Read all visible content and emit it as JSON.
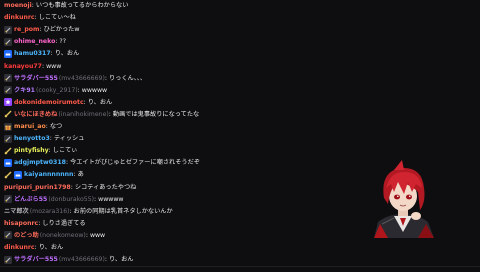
{
  "chat": {
    "messages": [
      {
        "name": "moenoji",
        "name_color": "#ff6b5b",
        "badge": "",
        "handle": "",
        "text": "いつも事故ってるからわからない"
      },
      {
        "name": "dinkunrc",
        "name_color": "#ff5a4a",
        "badge": "",
        "handle": "",
        "text": "しこてぃ〜ね"
      },
      {
        "name": "re_pom",
        "name_color": "#ff5a4a",
        "badge": "sword-badge-icon",
        "handle": "",
        "text": "ひどかったw"
      },
      {
        "name": "ohime_neko",
        "name_color": "#ff66cc",
        "badge": "sword-badge-icon",
        "handle": "",
        "text": "??"
      },
      {
        "name": "hamu0317",
        "name_color": "#4db6ff",
        "badge": "prime-crown-badge-icon",
        "handle": "",
        "text": "り、おん"
      },
      {
        "name": "kanayou77",
        "name_color": "#ff3b3b",
        "badge": "",
        "handle": "",
        "text": "www"
      },
      {
        "name": "サラダバー555",
        "name_color": "#c070ff",
        "badge": "sword-badge-icon",
        "handle": "(mv43666669)",
        "text": "りっくん、、、"
      },
      {
        "name": "クキ91",
        "name_color": "#b57bff",
        "badge": "sword-badge-icon",
        "handle": "(cooky_2917)",
        "text": "wwwww"
      },
      {
        "name": "dokonidemoirumotc",
        "name_color": "#ff5a4a",
        "badge": "star-badge-icon",
        "handle": "",
        "text": "り、おん"
      },
      {
        "name": "いなにほきめね",
        "name_color": "#ff6b5b",
        "badge": "sword-slash-badge-icon",
        "handle": "(inanihokimene)",
        "text": "動画では鬼事故りになってたな"
      },
      {
        "name": "marui_ao",
        "name_color": "#ff8c4a",
        "badge": "gift-badge-icon",
        "handle": "",
        "text": "なつ"
      },
      {
        "name": "henyotto3",
        "name_color": "#4db6ff",
        "badge": "sword-badge-icon",
        "handle": "",
        "text": "ティッシュ"
      },
      {
        "name": "pintyfishy",
        "name_color": "#e8f05a",
        "badge": "sword-slash-badge-icon",
        "handle": "",
        "text": "しこてぃ"
      },
      {
        "name": "adgjmptw0318",
        "name_color": "#4db6ff",
        "badge": "prime-crown-badge-icon",
        "handle": "",
        "text": "今エイトがびじゅとゼファーに嘲されそうだぞ"
      },
      {
        "name": "kaiyannnnnnn",
        "name_color": "#4db6ff",
        "badge": "sword-slash-prime-badge-icon",
        "handle": "",
        "text": "あ"
      },
      {
        "name": "puripuri_purin1798",
        "name_color": "#ff6b5b",
        "badge": "",
        "handle": "",
        "text": "シコティあったやつね"
      },
      {
        "name": "どんぶら55",
        "name_color": "#c070ff",
        "badge": "sword-badge-icon",
        "handle": "(donburako55)",
        "text": "wwwww"
      },
      {
        "name": "ニマ郎次",
        "name_color": "#b9b9c0",
        "badge": "",
        "handle": "(mozara316)",
        "text": "お前の同期は乳首ネタしかないんか"
      },
      {
        "name": "hisaponrc",
        "name_color": "#ff6b5b",
        "badge": "",
        "handle": "",
        "text": "しりさ過ぎてる"
      },
      {
        "name": "のどっ助",
        "name_color": "#ff6b5b",
        "badge": "sword-badge-icon",
        "handle": "(nonekomeow)",
        "text": "www"
      },
      {
        "name": "dinkunrc",
        "name_color": "#ff5a4a",
        "badge": "",
        "handle": "",
        "text": "り、おん"
      },
      {
        "name": "サラダバー555",
        "name_color": "#c070ff",
        "badge": "sword-badge-icon",
        "handle": "(mv43666669)",
        "text": "り、おん"
      }
    ]
  },
  "avatar": {
    "icon": "vtuber-avatar"
  }
}
